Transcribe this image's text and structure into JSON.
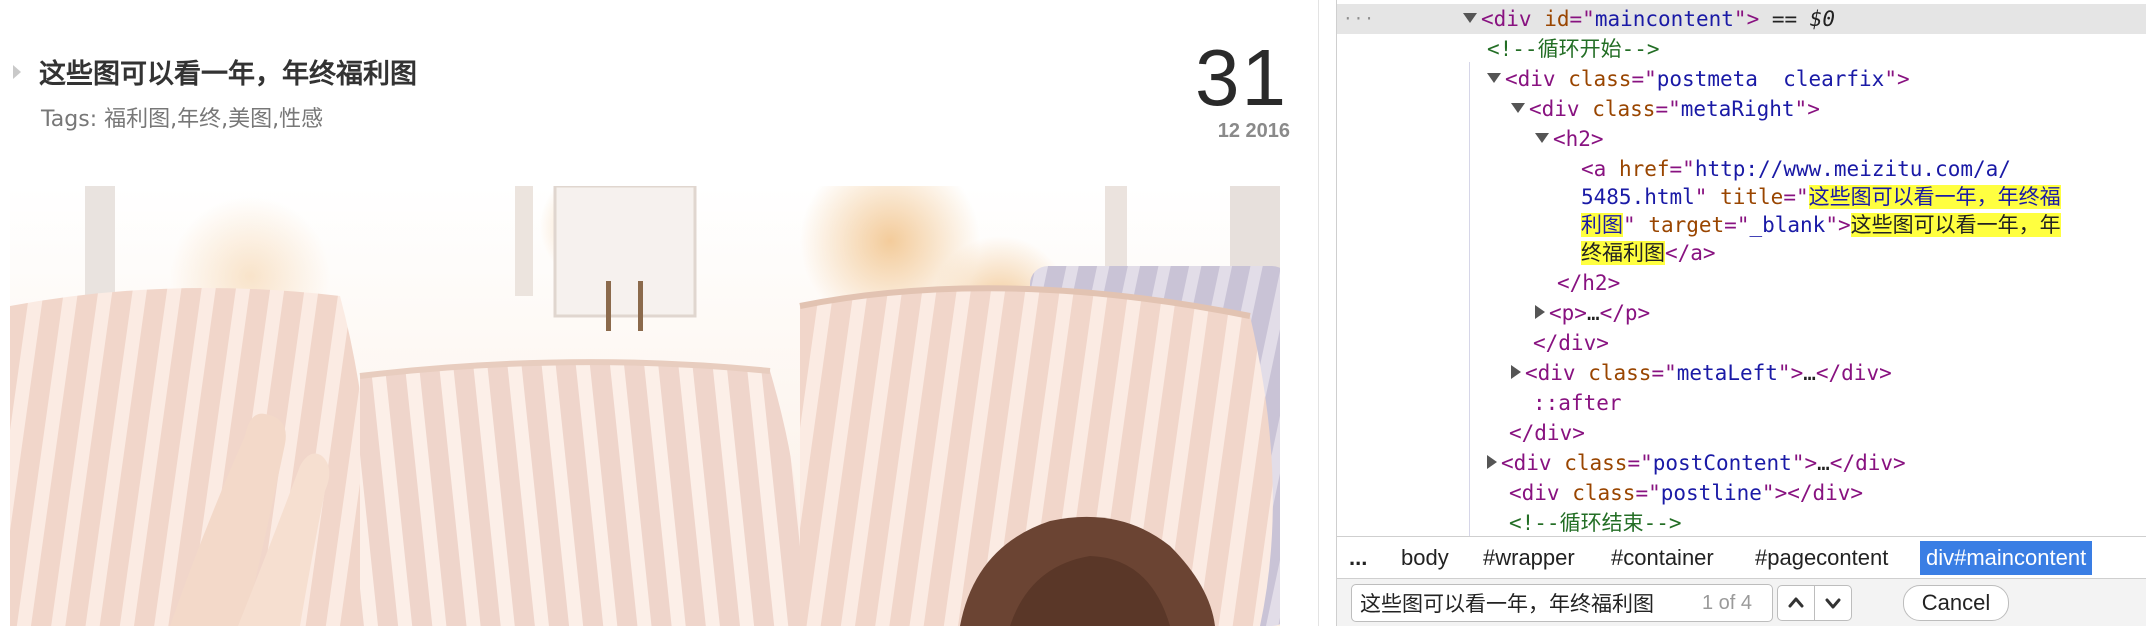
{
  "post": {
    "title": "这些图可以看一年，年终福利图",
    "tags_prefix": "Tags: ",
    "tags": [
      "福利图",
      "年终",
      "美图",
      "性感"
    ],
    "date_day": "31",
    "date_monthyear": "12 2016"
  },
  "devtools": {
    "gutter_ellipsis": "···",
    "selected_suffix": " == $0",
    "colors": {
      "tag": "#881280",
      "attr_name": "#994500",
      "attr_value": "#1a1aa6",
      "comment": "#236e25",
      "search_highlight": "#ffff40",
      "selected_crumb": "#3a7ee4"
    },
    "lines": [
      {
        "open_tag": "<div",
        "attr": "id",
        "value": "maincontent",
        "close": ">"
      },
      {
        "comment": "<!--循环开始-->"
      },
      {
        "open_tag": "<div",
        "attr": "class",
        "value": "postmeta  clearfix",
        "close": ">"
      },
      {
        "open_tag": "<div",
        "attr": "class",
        "value": "metaRight",
        "close": ">"
      },
      {
        "tag": "<h2>"
      },
      {
        "open_tag": "<a",
        "attr1": "href",
        "value1a": "http://www.meizitu.com/a/",
        "value1b": "5485.html",
        "attr2": "title",
        "value2a": "这些图可以看一年，年终福",
        "value2b": "利图",
        "attr3": "target",
        "value3": "_blank",
        "text_a": "这些图可以看一年，年",
        "text_b": "终福利图",
        "close_a": "</a>"
      },
      {
        "tag": "</h2>"
      },
      {
        "tag_open": "<p>",
        "ellipsis": "…",
        "tag_close": "</p>"
      },
      {
        "tag": "</div>"
      },
      {
        "open_tag": "<div",
        "attr": "class",
        "value": "metaLeft",
        "mid": ">",
        "ellipsis": "…",
        "close": "</div>"
      },
      {
        "pseudo": "::after"
      },
      {
        "tag": "</div>"
      },
      {
        "open_tag": "<div",
        "attr": "class",
        "value": "postContent",
        "mid": ">",
        "ellipsis": "…",
        "close": "</div>"
      },
      {
        "open_tag": "<div",
        "attr": "class",
        "value": "postline",
        "close": "></div>"
      },
      {
        "comment": "<!--循环结束-->"
      }
    ],
    "breadcrumbs": [
      "...",
      "body",
      "#wrapper",
      "#container",
      "#pagecontent",
      "div#maincontent"
    ],
    "search": {
      "query": "这些图可以看一年，年终福利图",
      "match_count": "1 of 4",
      "prev_icon": "chevron-up-icon",
      "next_icon": "chevron-down-icon",
      "cancel_label": "Cancel"
    }
  }
}
